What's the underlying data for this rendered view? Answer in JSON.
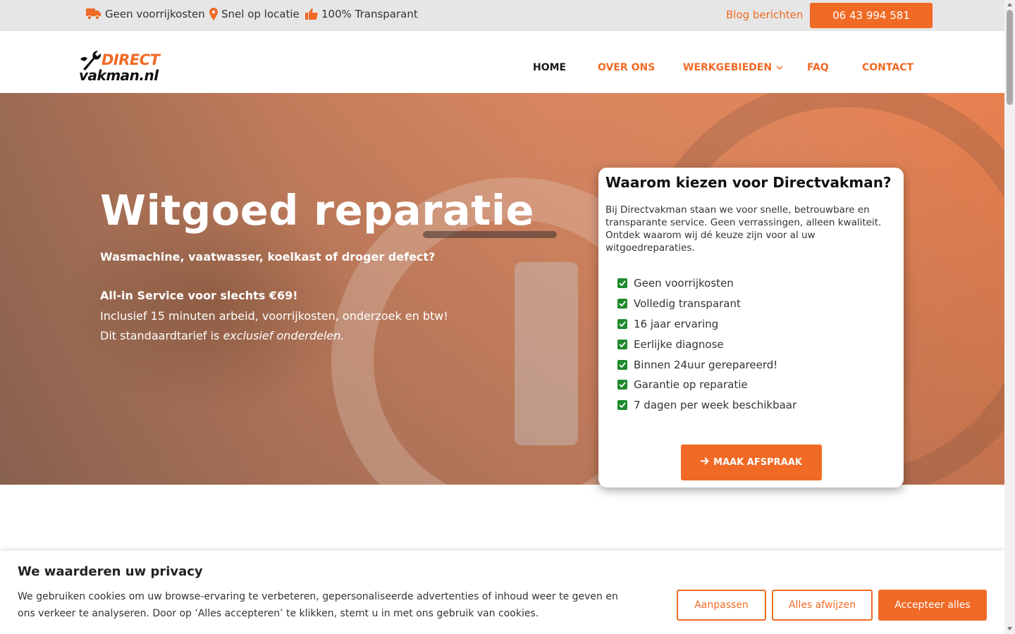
{
  "topbar": {
    "usps": [
      {
        "icon": "truck-icon",
        "label": "Geen voorrijkosten"
      },
      {
        "icon": "map-pin-icon",
        "label": "Snel op locatie"
      },
      {
        "icon": "thumbs-up-icon",
        "label": "100% Transparant"
      }
    ],
    "blog_label": "Blog berichten",
    "phone_label": "06 43 994 581"
  },
  "header": {
    "logo": {
      "line1": "DIRECT",
      "line2": "vakman.nl"
    },
    "nav": [
      {
        "label": "HOME",
        "active": true
      },
      {
        "label": "OVER ONS",
        "active": false
      },
      {
        "label": "WERKGEBIEDEN",
        "active": false,
        "has_dropdown": true
      },
      {
        "label": "FAQ",
        "active": false
      },
      {
        "label": "CONTACT",
        "active": false
      }
    ]
  },
  "hero": {
    "title": "Witgoed reparatie",
    "subtitle": "Wasmachine, vaatwasser, koelkast of droger defect?",
    "price_line": "All-in Service voor slechts €69!",
    "includes_line": "Inclusief 15 minuten arbeid, voorrijkosten, onderzoek en btw!",
    "tarief_prefix": "Dit standaardtarief is ",
    "tarief_emphasis": "exclusief onderdelen."
  },
  "card": {
    "title": "Waarom kiezen voor Directvakman?",
    "text": "Bij Directvakman staan we voor snelle, betrouwbare en transparante service. Geen verrassingen, alleen kwaliteit. Ontdek waarom wij dé keuze zijn voor al uw witgoedreparaties.",
    "checklist": [
      "Geen voorrijkosten",
      "Volledig transparant",
      "16 jaar ervaring",
      "Eerlijke diagnose",
      "Binnen 24uur gerepareerd!",
      "Garantie op reparatie",
      "7 dagen per week beschikbaar"
    ],
    "cta_label": "MAAK AFSPRAAK"
  },
  "cookie": {
    "title": "We waarderen uw privacy",
    "text": "We gebruiken cookies om uw browse-ervaring te verbeteren, gepersonaliseerde advertenties of inhoud weer te geven en ons verkeer te analyseren. Door op ‘Alles accepteren’ te klikken, stemt u in met ons gebruik van cookies.",
    "customize_label": "Aanpassen",
    "reject_label": "Alles afwijzen",
    "accept_label": "Accepteer alles"
  },
  "colors": {
    "accent": "#f06a25",
    "check_green": "#1e8a2d",
    "topbar_bg": "#e6e6e6"
  }
}
